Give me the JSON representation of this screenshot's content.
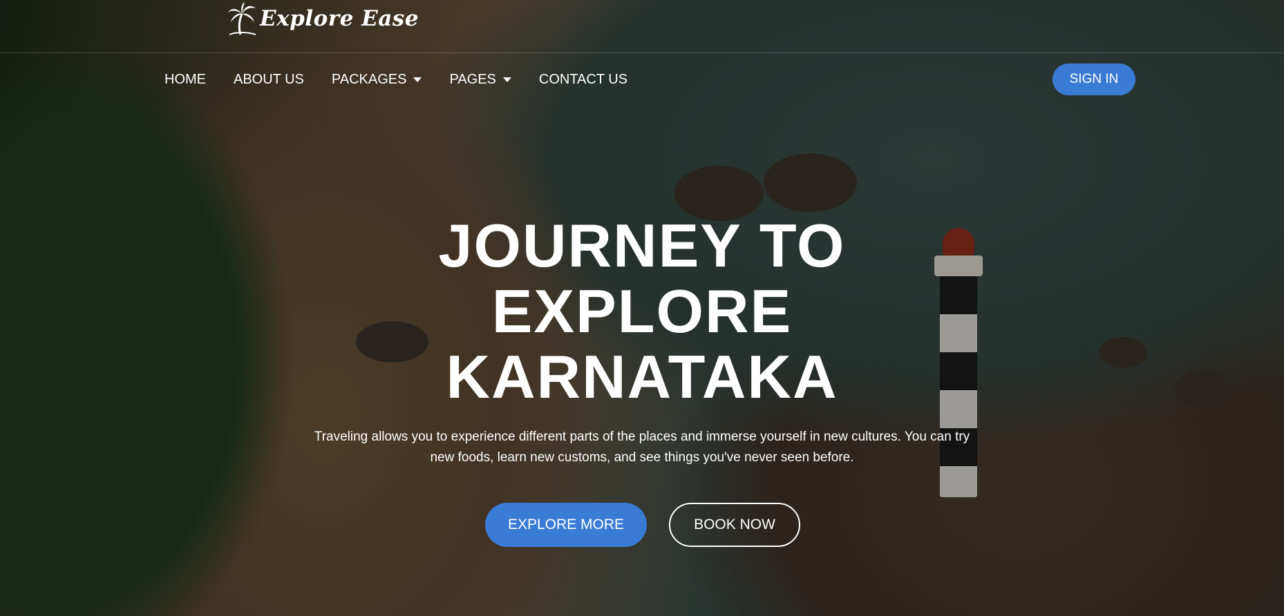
{
  "brand": {
    "name": "Explore Ease",
    "logo_icon": "palm-tree-icon"
  },
  "nav": {
    "items": [
      {
        "label": "HOME",
        "has_dropdown": false
      },
      {
        "label": "ABOUT US",
        "has_dropdown": false
      },
      {
        "label": "PACKAGES",
        "has_dropdown": true
      },
      {
        "label": "PAGES",
        "has_dropdown": true
      },
      {
        "label": "CONTACT US",
        "has_dropdown": false
      }
    ],
    "signin_label": "SIGN IN"
  },
  "hero": {
    "headline_lines": [
      "JOURNEY TO",
      "EXPLORE",
      "KARNATAKA"
    ],
    "tagline_lines": [
      "Traveling allows you to experience different parts of the places and immerse yourself in new cultures. You can try",
      "new foods, learn new customs, and see things you've never seen before."
    ],
    "primary_cta": "EXPLORE MORE",
    "secondary_cta": "BOOK NOW"
  },
  "colors": {
    "accent": "#3a7bd5",
    "text": "#ffffff"
  }
}
